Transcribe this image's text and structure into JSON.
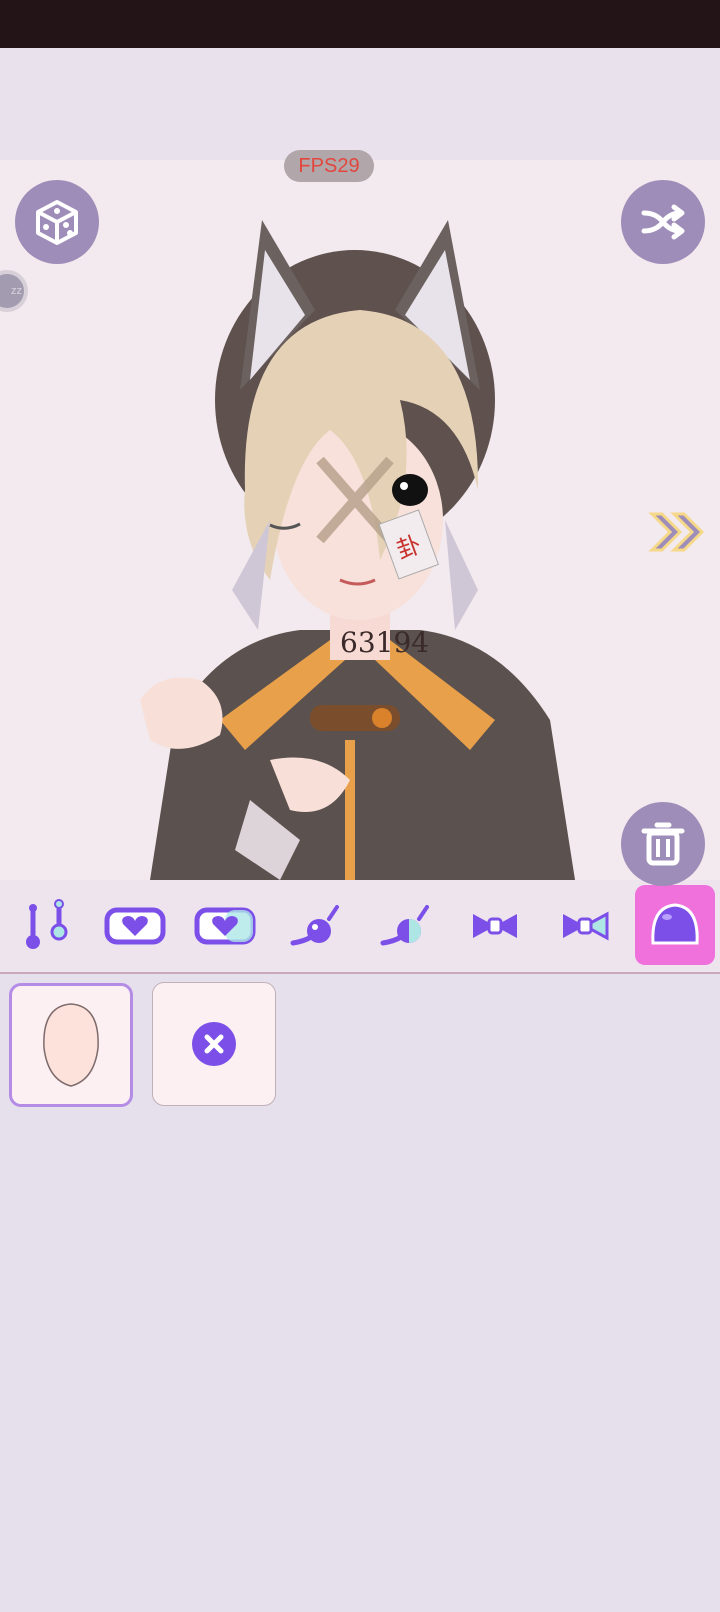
{
  "overlay": {
    "fps_label": "FPS29",
    "side_tab_label": "zz"
  },
  "toolbar": {
    "random_icon": "dice-icon",
    "shuffle_icon": "shuffle-icon",
    "delete_icon": "trash-icon",
    "next_icon": "double-chevron-right-icon"
  },
  "character": {
    "neck_tattoo": "63194",
    "face_card_glyph": "卦"
  },
  "categories": [
    {
      "icon": "body-pose-icon"
    },
    {
      "icon": "heart-badge-icon"
    },
    {
      "icon": "heart-badge-variant-icon"
    },
    {
      "icon": "blush-swatch-icon"
    },
    {
      "icon": "blush-swatch-variant-icon"
    },
    {
      "icon": "bow-icon"
    },
    {
      "icon": "bow-variant-icon"
    },
    {
      "icon": "head-shape-icon",
      "selected": true
    }
  ],
  "options": [
    {
      "icon": "face-skin-icon",
      "selected": true
    },
    {
      "icon": "remove-icon",
      "selected": false
    }
  ],
  "colors": {
    "accent": "#7b4fe8",
    "highlight": "#f070dc",
    "button": "#9e8db8",
    "fps_text": "#e2463d"
  }
}
